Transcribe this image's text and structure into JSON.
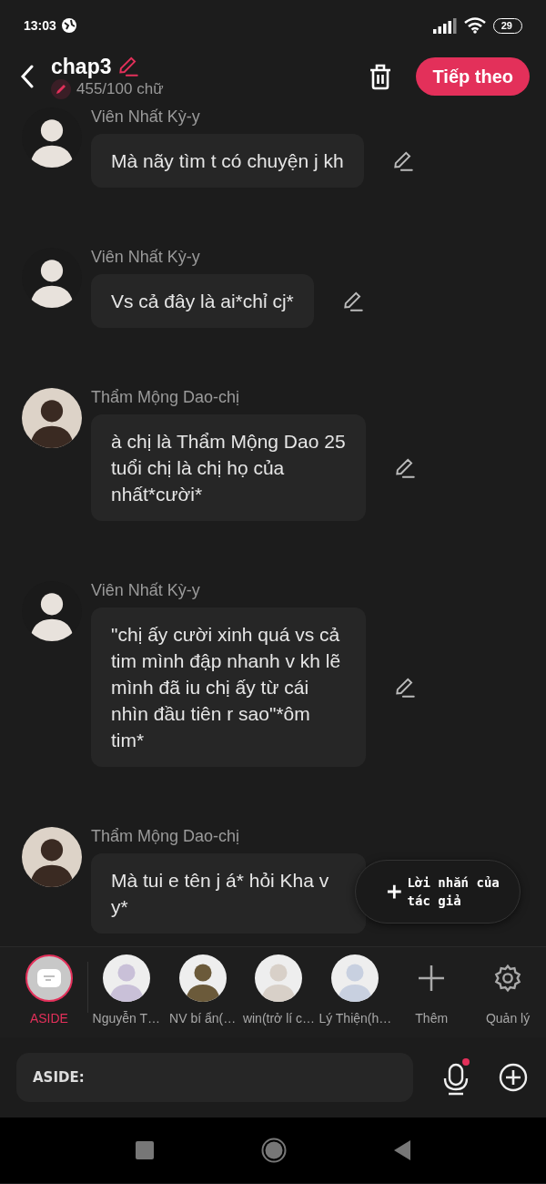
{
  "status_bar": {
    "time": "13:03",
    "battery": "29"
  },
  "header": {
    "title": "chap3",
    "word_count": "455/100 chữ",
    "next_button": "Tiếp theo"
  },
  "messages": [
    {
      "speaker": "Viên Nhất Kỳ-y",
      "text": "Mà nãy tìm t có chuyện j kh"
    },
    {
      "speaker": "Viên Nhất Kỳ-y",
      "text": "Vs cả đây là ai*chỉ cj*"
    },
    {
      "speaker": "Thẩm Mộng Dao-chị",
      "text": "à chị là Thẩm Mộng Dao 25 tuổi chị là chị họ của nhất*cười*"
    },
    {
      "speaker": "Viên Nhất Kỳ-y",
      "text": "\"chị ấy cười xinh quá vs cả tim mình đập nhanh v kh lẽ mình đã iu chị ấy từ cái nhìn đầu tiên r sao\"*ôm tim*"
    },
    {
      "speaker": "Thẩm Mộng Dao-chị",
      "text": "Mà tui e tên j á* hỏi Kha v y*"
    }
  ],
  "author_note_button": "Lời nhắn của tác giả",
  "cast": [
    {
      "kind": "aside",
      "name": "ASIDE",
      "selected": true
    },
    {
      "kind": "character",
      "name": "Nguyễn T…",
      "selected": false
    },
    {
      "kind": "character",
      "name": "NV bí ẩn(…",
      "selected": false
    },
    {
      "kind": "character",
      "name": "win(trở lí c…",
      "selected": false
    },
    {
      "kind": "character",
      "name": "Lý Thiện(h…",
      "selected": false
    },
    {
      "kind": "add",
      "name": "Thêm",
      "selected": false
    },
    {
      "kind": "manage",
      "name": "Quản lý",
      "selected": false
    }
  ],
  "composer": {
    "prefix": "ASIDE:"
  }
}
